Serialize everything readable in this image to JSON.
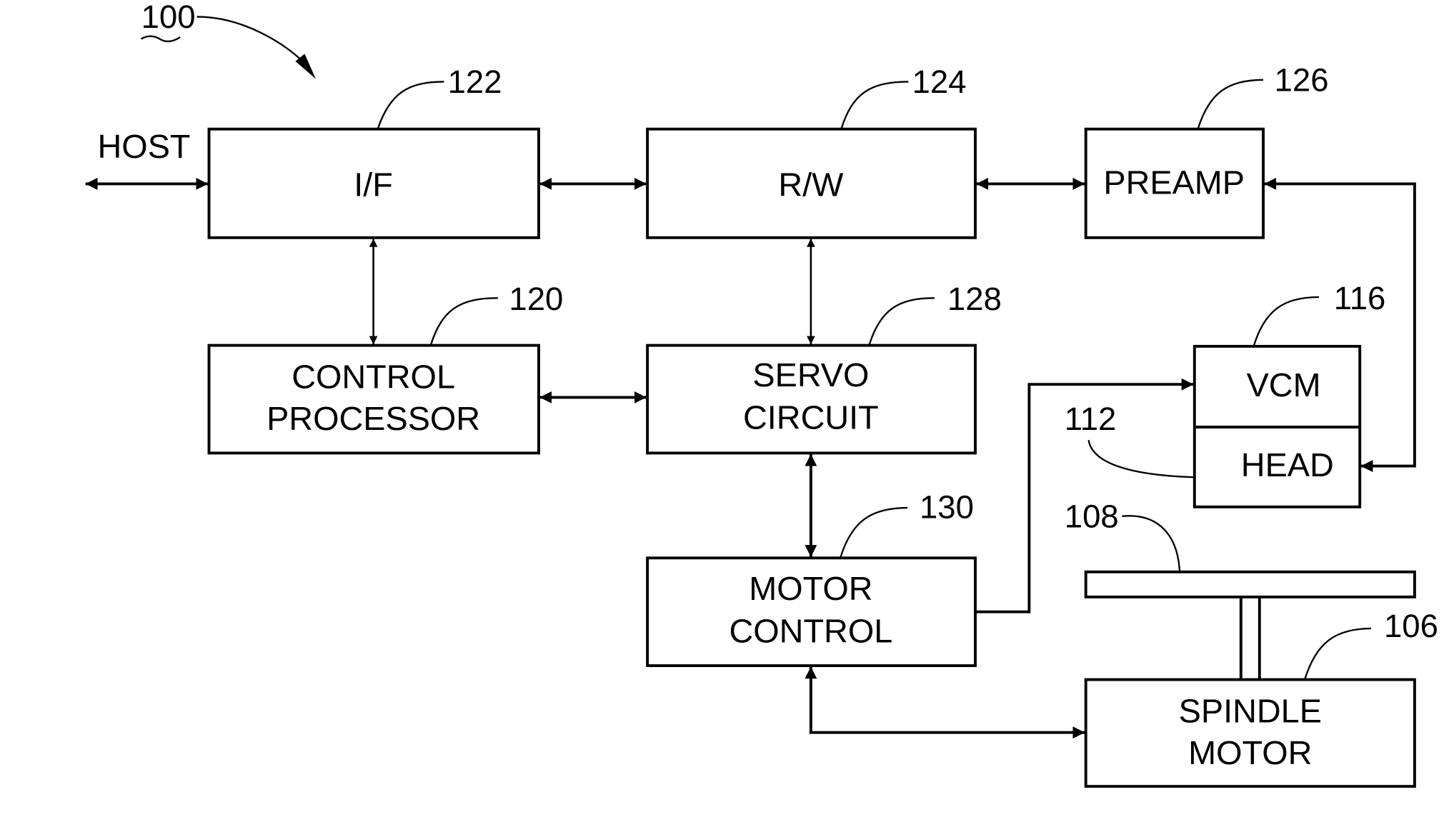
{
  "figure": {
    "ref": "100",
    "host_label": "HOST"
  },
  "blocks": {
    "interface": {
      "label": "I/F",
      "ref": "122"
    },
    "read_write": {
      "label": "R/W",
      "ref": "124"
    },
    "preamp": {
      "label": "PREAMP",
      "ref": "126"
    },
    "control_processor": {
      "line1": "CONTROL",
      "line2": "PROCESSOR",
      "ref": "120"
    },
    "servo_circuit": {
      "line1": "SERVO",
      "line2": "CIRCUIT",
      "ref": "128"
    },
    "motor_control": {
      "line1": "MOTOR",
      "line2": "CONTROL",
      "ref": "130"
    },
    "vcm": {
      "label": "VCM",
      "ref": "116"
    },
    "head": {
      "label": "HEAD",
      "ref": "112"
    },
    "disc": {
      "ref": "108"
    },
    "spindle_motor": {
      "line1": "SPINDLE",
      "line2": "MOTOR",
      "ref": "106"
    }
  }
}
